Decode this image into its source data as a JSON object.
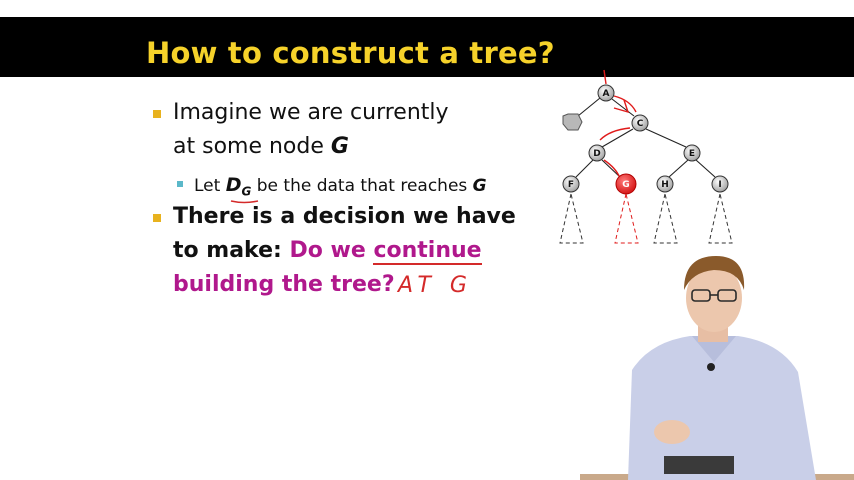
{
  "slide": {
    "title": "How to construct a tree?",
    "bullet1_line1": "Imagine we are currently",
    "bullet1_line2_prefix": "at some node ",
    "bullet1_node": "G",
    "sub_prefix": "Let ",
    "sub_symbol": "D",
    "sub_symbol_subscript": "G",
    "sub_middle": " be the data that reaches ",
    "sub_node": "G",
    "bullet2_line1": "There is a decision we have",
    "bullet2_line2_prefix": "to make: ",
    "bullet2_line2_highlight_a": "Do we ",
    "bullet2_line2_highlight_b": "continue",
    "bullet2_line3": "building the tree?",
    "handwritten_note": "AT G"
  },
  "tree": {
    "nodes": [
      "A",
      "C",
      "D",
      "E",
      "F",
      "G",
      "H",
      "I"
    ],
    "highlight_node": "G"
  },
  "colors": {
    "title": "#f6d22a",
    "title_bar": "#000000",
    "bullet": "#e8b21e",
    "sub_bullet": "#5bb8c9",
    "emphasis": "#b0188c",
    "annotation": "#d42a2a"
  }
}
